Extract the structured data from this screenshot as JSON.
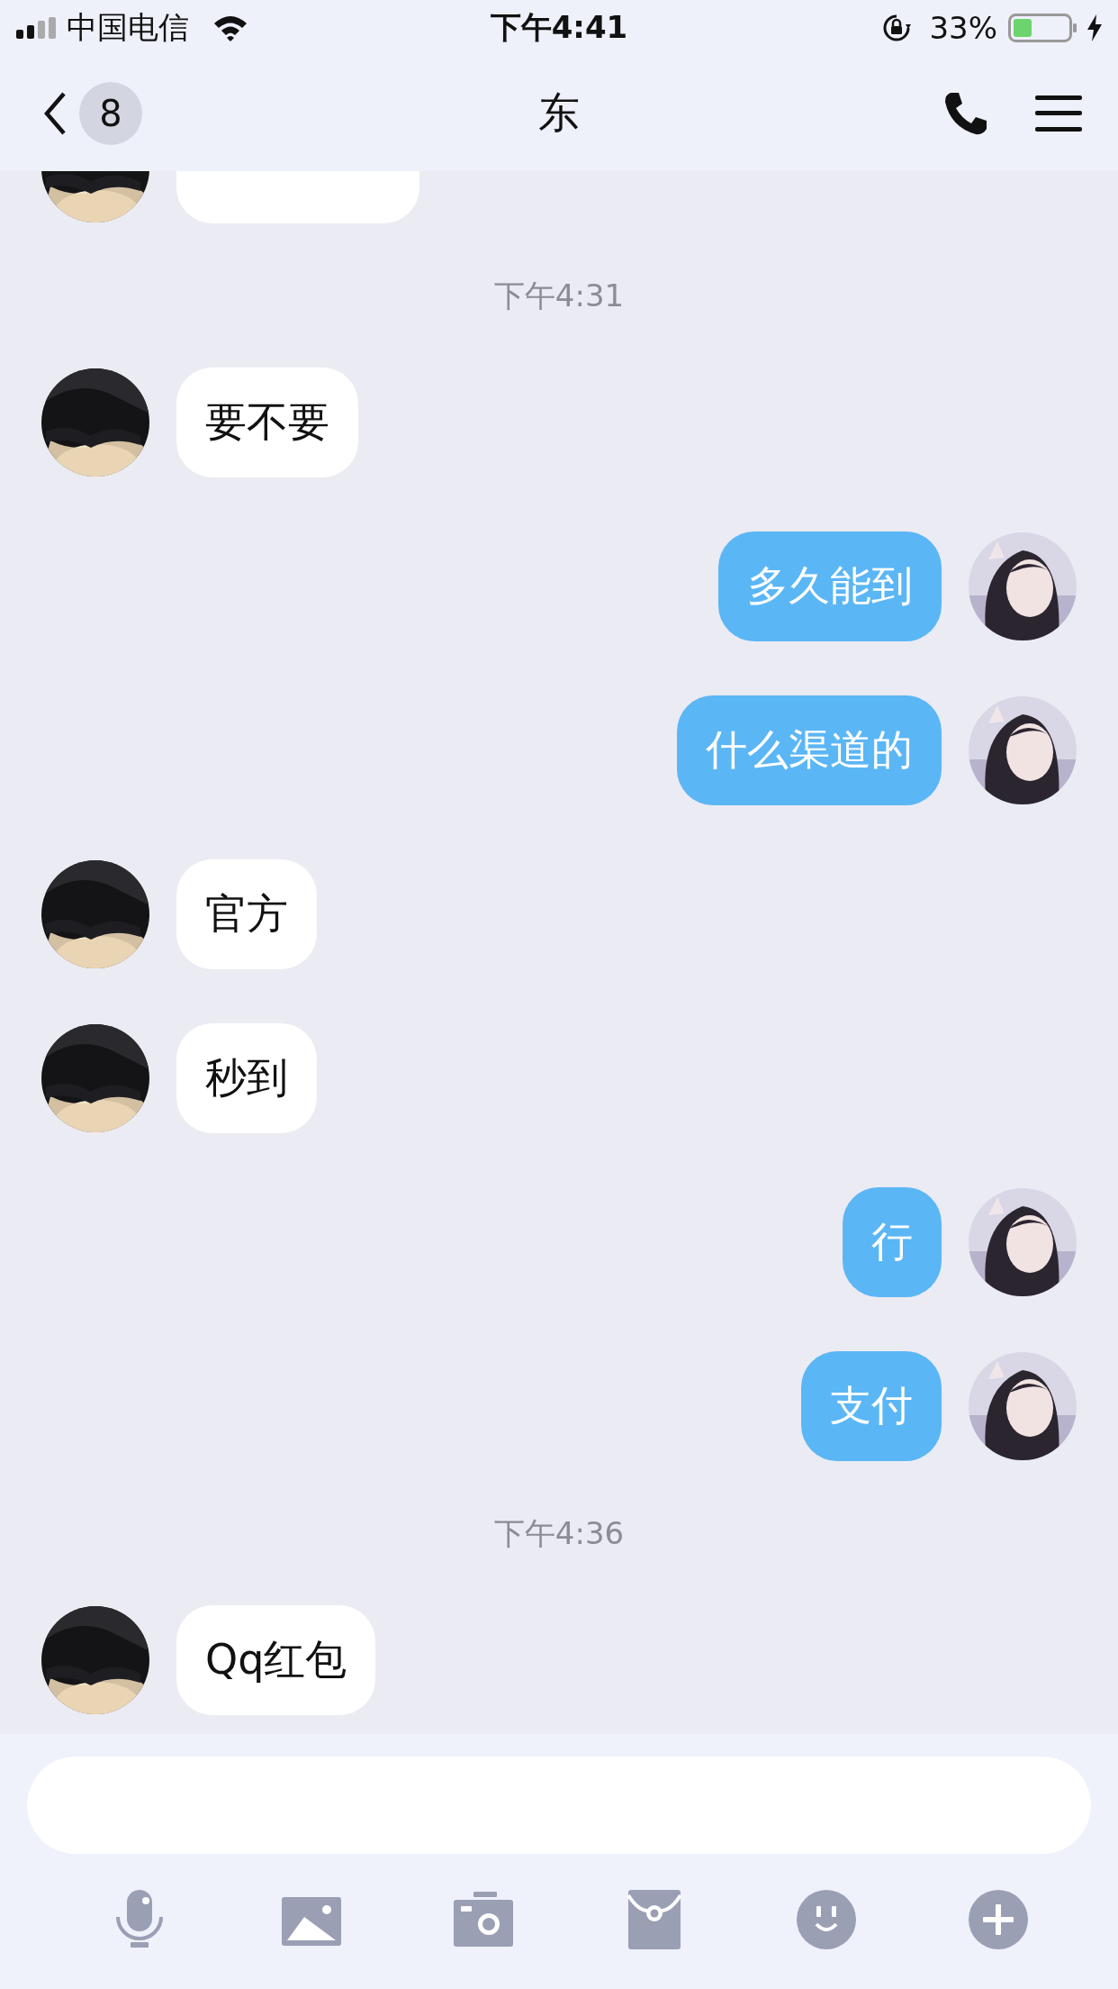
{
  "status_bar": {
    "carrier": "中国电信",
    "time": "下午4:41",
    "battery_percent": "33%"
  },
  "header": {
    "unread_count": "8",
    "title": "东"
  },
  "messages": [
    {
      "kind": "cut_received"
    },
    {
      "kind": "timestamp",
      "text": "下午4:31"
    },
    {
      "kind": "received",
      "text": "要不要"
    },
    {
      "kind": "sent",
      "text": "多久能到"
    },
    {
      "kind": "sent",
      "text": "什么渠道的"
    },
    {
      "kind": "received",
      "text": "官方"
    },
    {
      "kind": "received",
      "text": "秒到"
    },
    {
      "kind": "sent",
      "text": "行"
    },
    {
      "kind": "sent",
      "text": "支付"
    },
    {
      "kind": "timestamp",
      "text": "下午4:36"
    },
    {
      "kind": "received",
      "text": "Qq红包"
    }
  ]
}
